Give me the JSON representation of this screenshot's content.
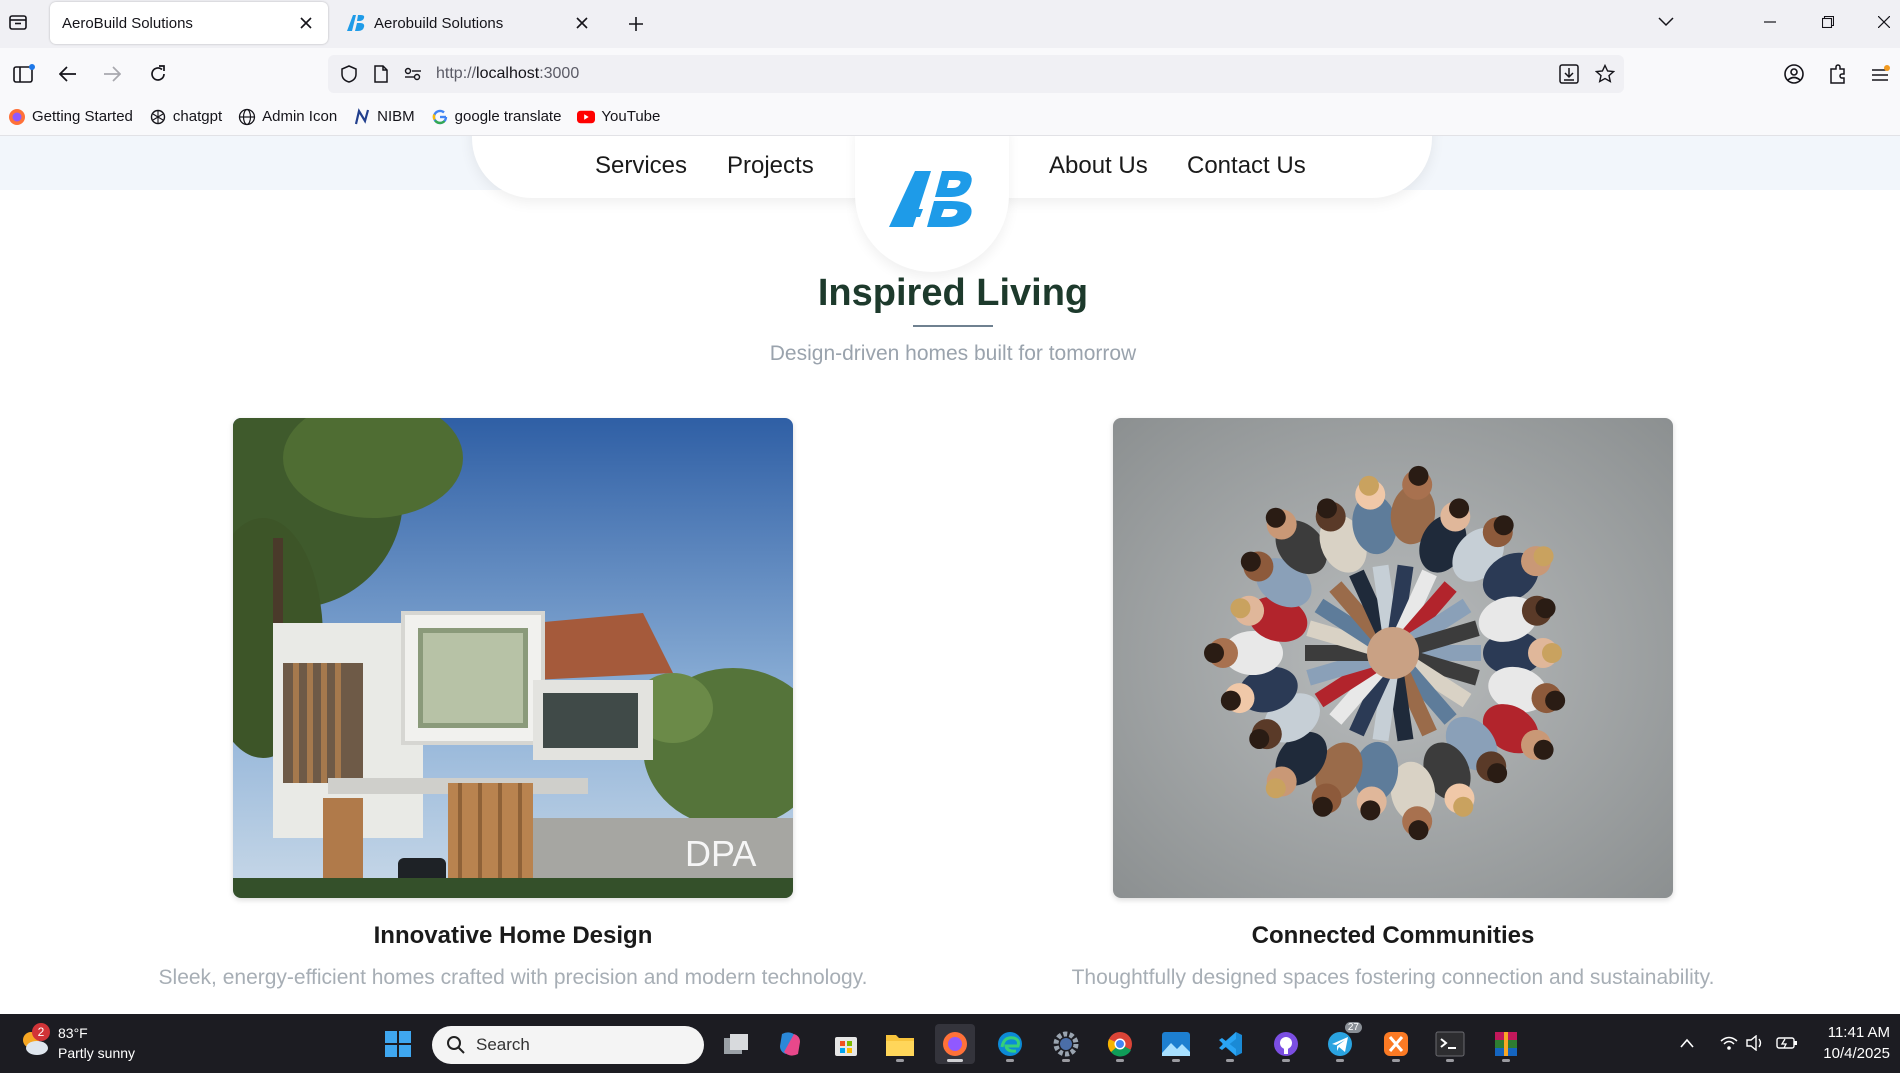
{
  "browser": {
    "tabs": [
      {
        "title": "AeroBuild Solutions",
        "active": true
      },
      {
        "title": "Aerobuild Solutions",
        "active": false
      }
    ],
    "url": {
      "scheme": "http://",
      "host": "localhost",
      "port": ":3000"
    },
    "bookmarks": [
      {
        "label": "Getting Started",
        "icon": "firefox-icon"
      },
      {
        "label": "chatgpt",
        "icon": "openai-icon"
      },
      {
        "label": "Admin Icon",
        "icon": "globe-icon"
      },
      {
        "label": "NIBM",
        "icon": "nibm-icon"
      },
      {
        "label": "google translate",
        "icon": "google-icon"
      },
      {
        "label": "YouTube",
        "icon": "youtube-icon"
      }
    ]
  },
  "site": {
    "nav": {
      "services": "Services",
      "projects": "Projects",
      "about": "About Us",
      "contact": "Contact Us",
      "logo_text": "AB"
    },
    "section": {
      "title": "Inspired Living",
      "subtitle": "Design-driven homes built for tomorrow"
    },
    "cards": [
      {
        "title": "Innovative Home Design",
        "description": "Sleek, energy-efficient homes crafted with precision and modern technology.",
        "image_caption": "DPA"
      },
      {
        "title": "Connected Communities",
        "description": "Thoughtfully designed spaces fostering connection and sustainability."
      }
    ]
  },
  "taskbar": {
    "weather": {
      "temp": "83°F",
      "condition": "Partly sunny",
      "badge": "2"
    },
    "search_placeholder": "Search",
    "telegram_badge": "27",
    "time": "11:41 AM",
    "date": "10/4/2025"
  },
  "colors": {
    "brand_blue": "#1e9be8",
    "title_green": "#1d3a2c",
    "muted_text": "#a7aeb5",
    "taskbar_bg": "#1c1c22"
  }
}
